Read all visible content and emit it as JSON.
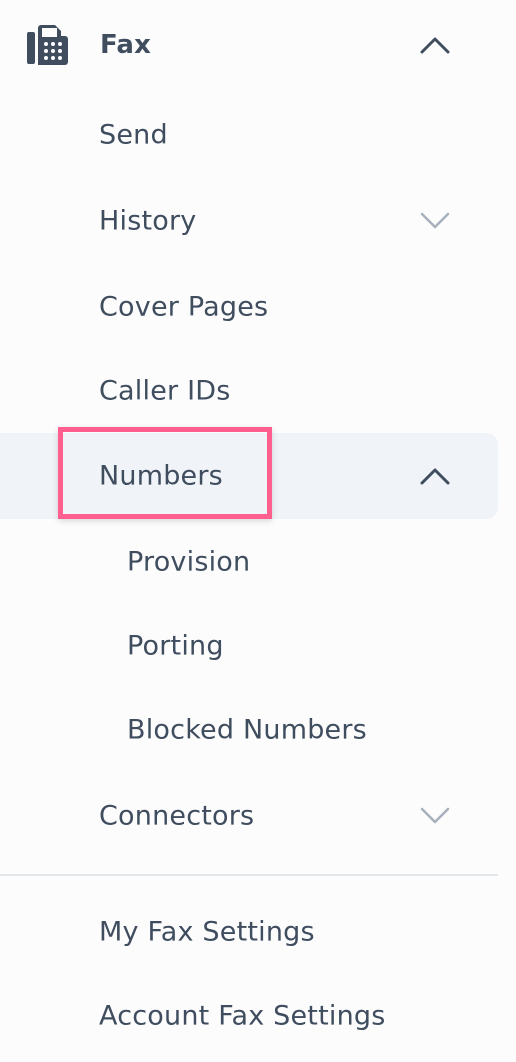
{
  "header": {
    "title": "Fax",
    "icon": "fax-icon"
  },
  "items": {
    "send": "Send",
    "history": "History",
    "cover_pages": "Cover Pages",
    "caller_ids": "Caller IDs",
    "numbers": "Numbers",
    "numbers_sub": {
      "provision": "Provision",
      "porting": "Porting",
      "blocked_numbers": "Blocked Numbers"
    },
    "connectors": "Connectors"
  },
  "footer": {
    "my_fax_settings": "My Fax Settings",
    "account_fax_settings": "Account Fax Settings"
  },
  "colors": {
    "text": "#3f4d5f",
    "chevron": "#a7b0bc",
    "selected_bg": "#f0f3f7",
    "highlight": "#ff5f8f"
  }
}
